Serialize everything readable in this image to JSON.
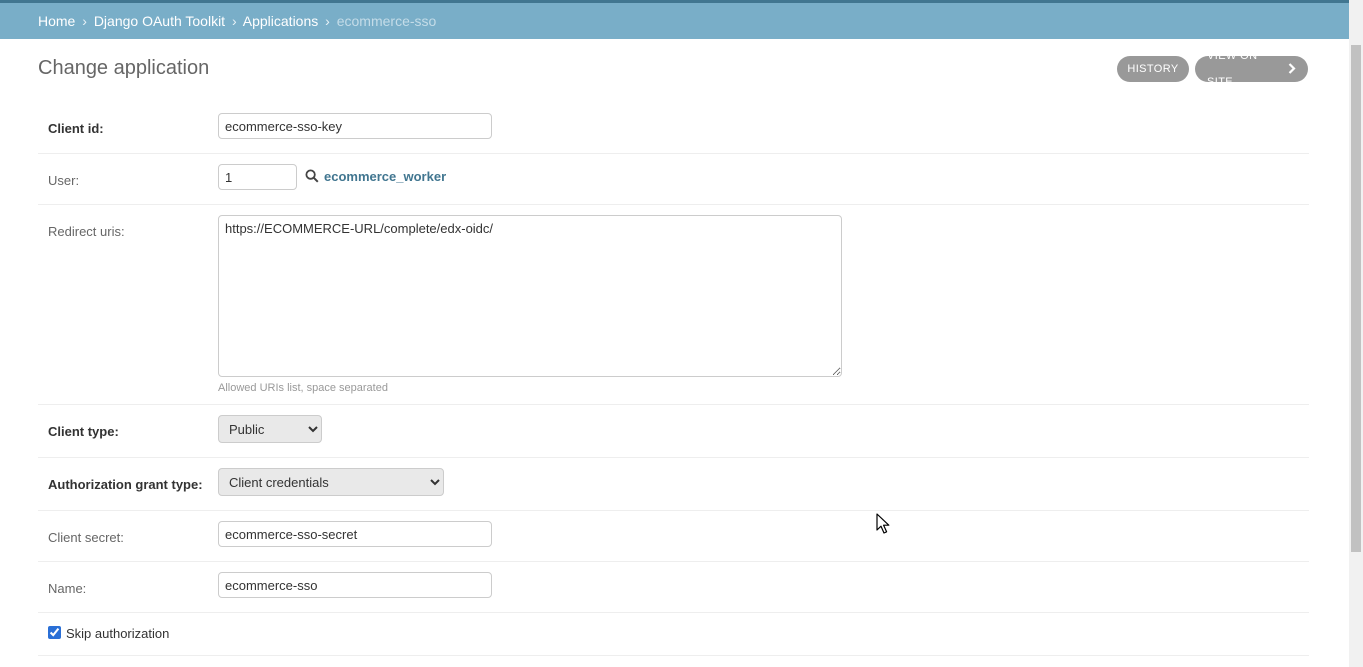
{
  "breadcrumbs": {
    "home": "Home",
    "app": "Django OAuth Toolkit",
    "model": "Applications",
    "current": "ecommerce-sso",
    "separator": "›"
  },
  "page": {
    "title": "Change application"
  },
  "object_tools": {
    "history": "HISTORY",
    "view_on_site": "VIEW ON SITE"
  },
  "form": {
    "client_id": {
      "label": "Client id:",
      "value": "ecommerce-sso-key"
    },
    "user": {
      "label": "User:",
      "value": "1",
      "display": "ecommerce_worker"
    },
    "redirect_uris": {
      "label": "Redirect uris:",
      "value": "https://ECOMMERCE-URL/complete/edx-oidc/",
      "help": "Allowed URIs list, space separated"
    },
    "client_type": {
      "label": "Client type:",
      "selected": "Public"
    },
    "grant_type": {
      "label": "Authorization grant type:",
      "selected": "Client credentials"
    },
    "client_secret": {
      "label": "Client secret:",
      "value": "ecommerce-sso-secret"
    },
    "name": {
      "label": "Name:",
      "value": "ecommerce-sso"
    },
    "skip_authorization": {
      "label": "Skip authorization",
      "checked": true
    }
  },
  "colors": {
    "header": "#79aec8",
    "header_dark": "#417690",
    "link": "#417690",
    "button_grey": "#999999"
  },
  "icons": [
    "search-icon",
    "chevron-right-icon",
    "mouse-cursor-icon"
  ]
}
